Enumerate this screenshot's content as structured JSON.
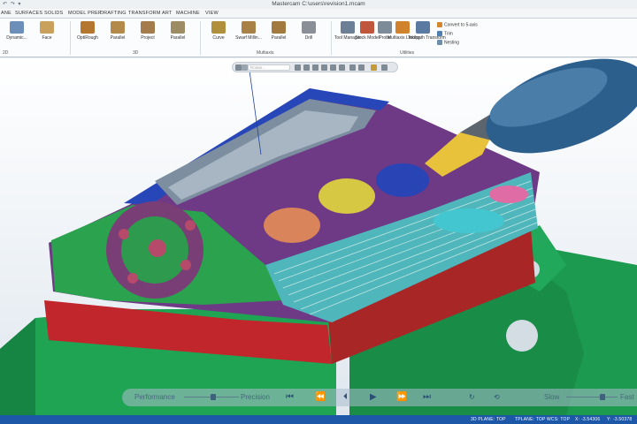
{
  "window": {
    "title": "Mastercam C:\\users\\revision1.mcam",
    "quick_access": "↶ ↷ ▾"
  },
  "tabs": [
    "ANE",
    "SURFACES",
    "SOLIDS",
    "MODEL PREP",
    "DRAFTING",
    "TRANSFORM",
    "ART",
    "MACHINE",
    "VIEW"
  ],
  "ribbon": {
    "buttons": [
      {
        "label": "Dynamic...",
        "color": "#6b8fb8"
      },
      {
        "label": "Face",
        "color": "#c9a15c"
      },
      {
        "label": "OptiRough",
        "color": "#b5772f"
      },
      {
        "label": "Parallel",
        "color": "#b38a4a"
      },
      {
        "label": "Project",
        "color": "#a47b4b"
      },
      {
        "label": "Parallel",
        "color": "#9d8b63"
      },
      {
        "label": "Curve",
        "color": "#b0903d"
      },
      {
        "label": "Swarf Millin...",
        "color": "#a88146"
      },
      {
        "label": "Parallel",
        "color": "#a27a40"
      },
      {
        "label": "Drill",
        "color": "#8a8f97"
      },
      {
        "label": "Tool Manager",
        "color": "#6d7f95"
      },
      {
        "label": "Stock Model",
        "color": "#c0563c"
      },
      {
        "label": "Probe",
        "color": "#7d8a98"
      },
      {
        "label": "Multiaxis Linking",
        "color": "#d1822c"
      },
      {
        "label": "Toolpath Transform",
        "color": "#5b7aa1"
      }
    ],
    "small_buttons": [
      {
        "label": "Convert to 5-axis",
        "color": "#d3862c"
      },
      {
        "label": "Trim",
        "color": "#4f7fb2"
      },
      {
        "label": "Nesting",
        "color": "#6e8fab"
      }
    ],
    "groups": [
      "2D",
      "3D",
      "Multiaxis",
      "Utilities"
    ]
  },
  "floating_toolbar": {
    "input_placeholder": "Rotate..."
  },
  "playback": {
    "performance": "Performance",
    "precision": "Precision",
    "slow": "Slow",
    "fast": "Fast",
    "controls": [
      "⏮",
      "⏪",
      "⏴",
      "▶",
      "⏩",
      "⏭"
    ]
  },
  "status": {
    "gview": "3D  PLANE: TOP",
    "tplane": "TPLANE: TOP",
    "wcs": "WCS: TOP",
    "x_label": "X:",
    "x_val": "-3.54306",
    "y_label": "Y:",
    "y_val": "-3.50378"
  }
}
